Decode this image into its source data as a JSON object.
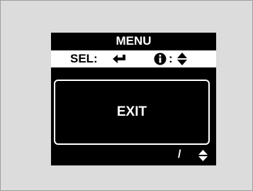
{
  "menu": {
    "title": "MENU",
    "select_label": "SEL:",
    "select_icon": "enter-arrow-icon",
    "info_icon": "info-icon",
    "info_separator": ":",
    "info_action_icon": "up-down-arrows-icon"
  },
  "items": [
    {
      "label": "EXIT",
      "selected": true
    }
  ],
  "footer": {
    "page_separator": "/",
    "page_icon": "up-down-arrows-icon"
  },
  "colors": {
    "screen_background": "#000000",
    "screen_text": "#ffffff",
    "selection_bar": "#ffffff",
    "surround": "#dcdcdc"
  }
}
